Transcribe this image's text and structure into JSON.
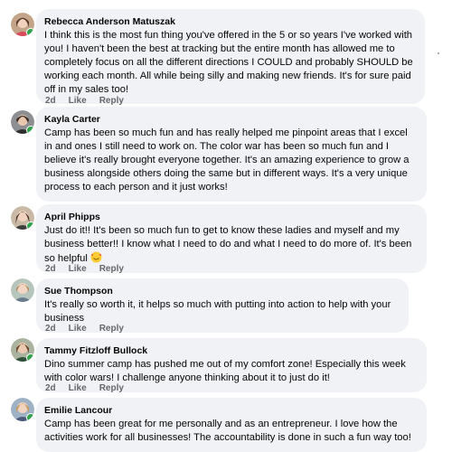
{
  "comments": [
    {
      "name": "Rebecca Anderson Matuszak",
      "text": "I think this is the most fun thing you've offered in the 5 or so years I've worked with you! I haven't been the best at tracking but the entire month has allowed me to completely focus on all the different directions I COULD and probably SHOULD be working each month. All while being silly and making new friends. It's for sure paid off in my sales too!",
      "time": "2d",
      "like": "Like",
      "reply": "Reply"
    },
    {
      "name": "Kayla Carter",
      "text": "Camp has been so much fun and has really helped me pinpoint areas that I excel in and ones I still need to work on. The color war has been so much fun and I believe it's really brought everyone together. It's an amazing experience to grow a business alongside others doing the same but in different ways. It's a very unique process to each person and it just works!",
      "time": "",
      "like": "",
      "reply": ""
    },
    {
      "name": "April Phipps",
      "text": "Just do it!! It's been so much fun to get to know these ladies and myself and my business better!! I know what I need to do and what I need to do more of. It's been so helpful",
      "emoji": "smiling-face-with-hearts-icon",
      "time": "2d",
      "like": "Like",
      "reply": "Reply"
    },
    {
      "name": "Sue Thompson",
      "text": "It's really so worth it, it helps so much with putting into action to help with your business",
      "time": "2d",
      "like": "Like",
      "reply": "Reply"
    },
    {
      "name": "Tammy Fitzloff Bullock",
      "text": "Dino summer camp has pushed me out of my comfort zone! Especially this week with color wars! I challenge anyone thinking about it to just do it!",
      "time": "2d",
      "like": "Like",
      "reply": "Reply"
    },
    {
      "name": "Emilie Lancour",
      "text": "Camp has been great for me personally and as an entrepreneur. I love how the activities work for all businesses! The accountability is done in such a fun way too!",
      "time": "",
      "like": "",
      "reply": ""
    }
  ],
  "colors": {
    "bubble": "#f0f2f5",
    "meta": "#65676b",
    "online": "#31a24c"
  }
}
